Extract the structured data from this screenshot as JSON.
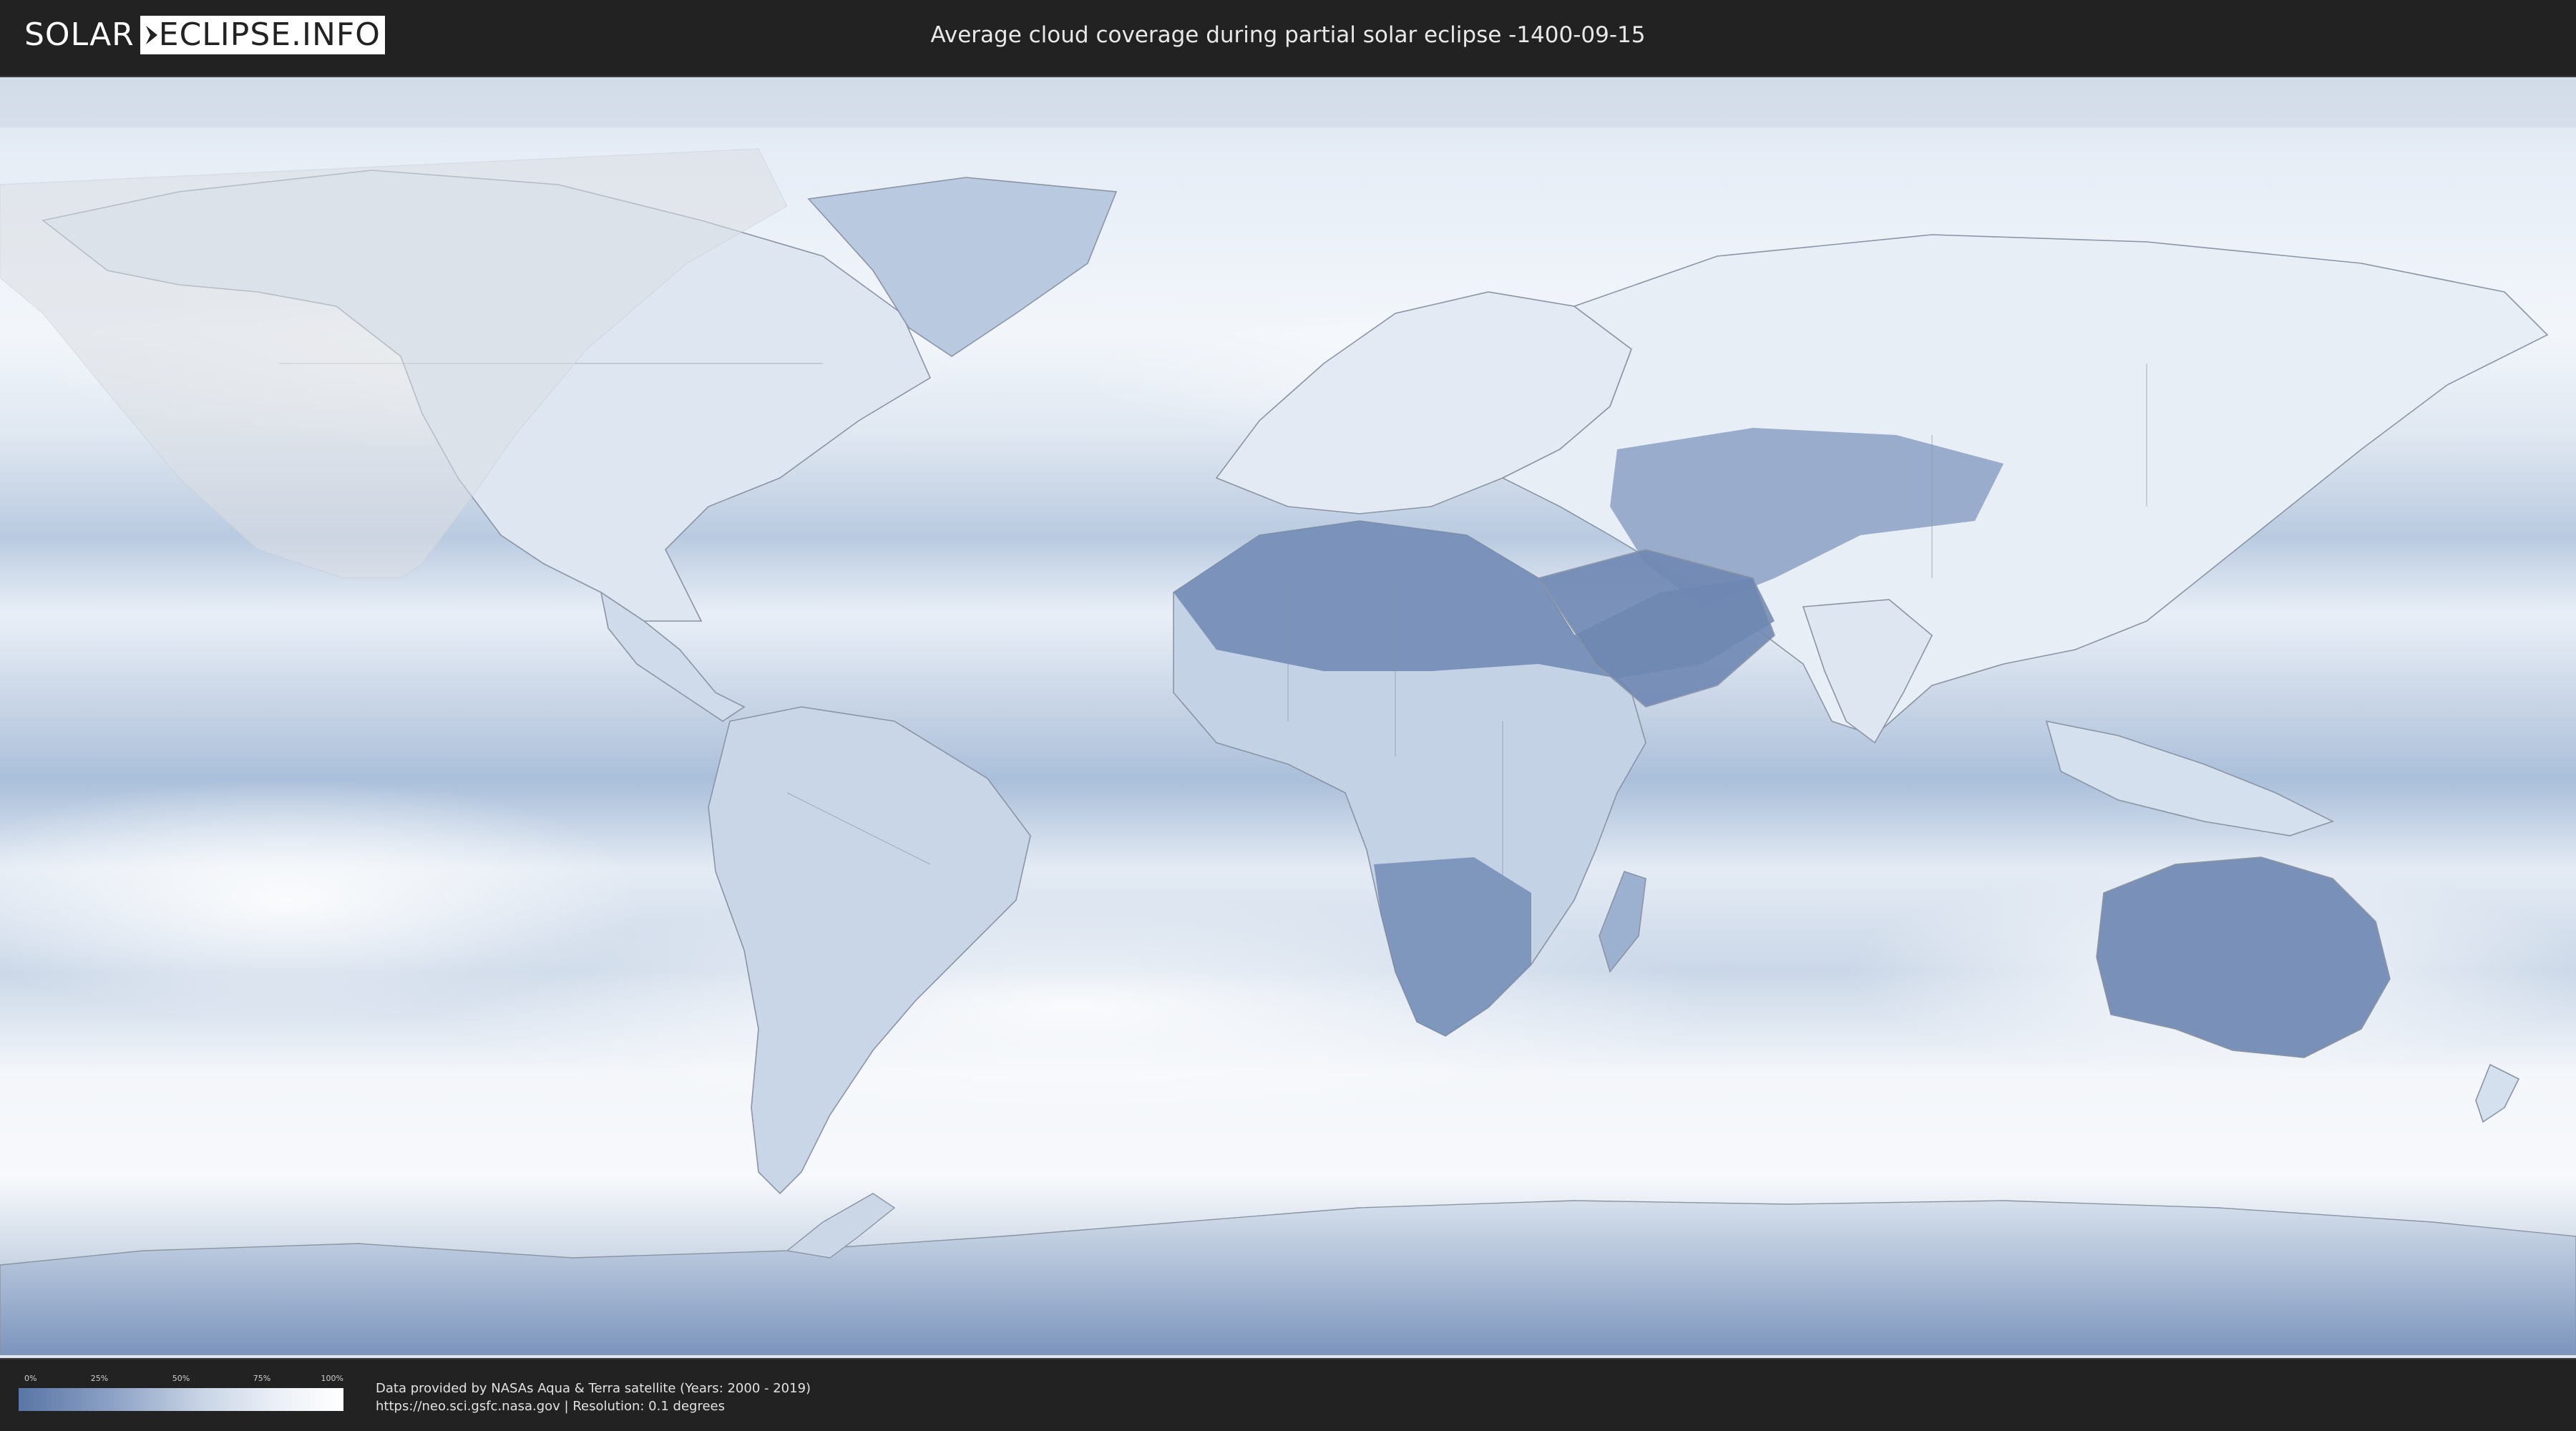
{
  "header": {
    "logo_left": "SOLAR",
    "logo_right": "ECLIPSE.INFO",
    "title": "Average cloud coverage during partial solar eclipse -1400-09-15"
  },
  "legend": {
    "ticks": [
      "0%",
      "25%",
      "50%",
      "75%",
      "100%"
    ],
    "color_low": "#5a76a6",
    "color_high": "#ffffff"
  },
  "footer": {
    "credit_line": "Data provided by NASAs Aqua & Terra satellite (Years: 2000 - 2019)",
    "source_line": "https://neo.sci.gsfc.nasa.gov | Resolution: 0.1 degrees"
  },
  "map": {
    "colors": {
      "ocean_clear": "#a9bdd9",
      "cloud": "#f4f7fb",
      "desert_clear": "#6f88b3",
      "border": "#8a94a3",
      "eclipse_shadow": "#d8dbe0"
    }
  }
}
